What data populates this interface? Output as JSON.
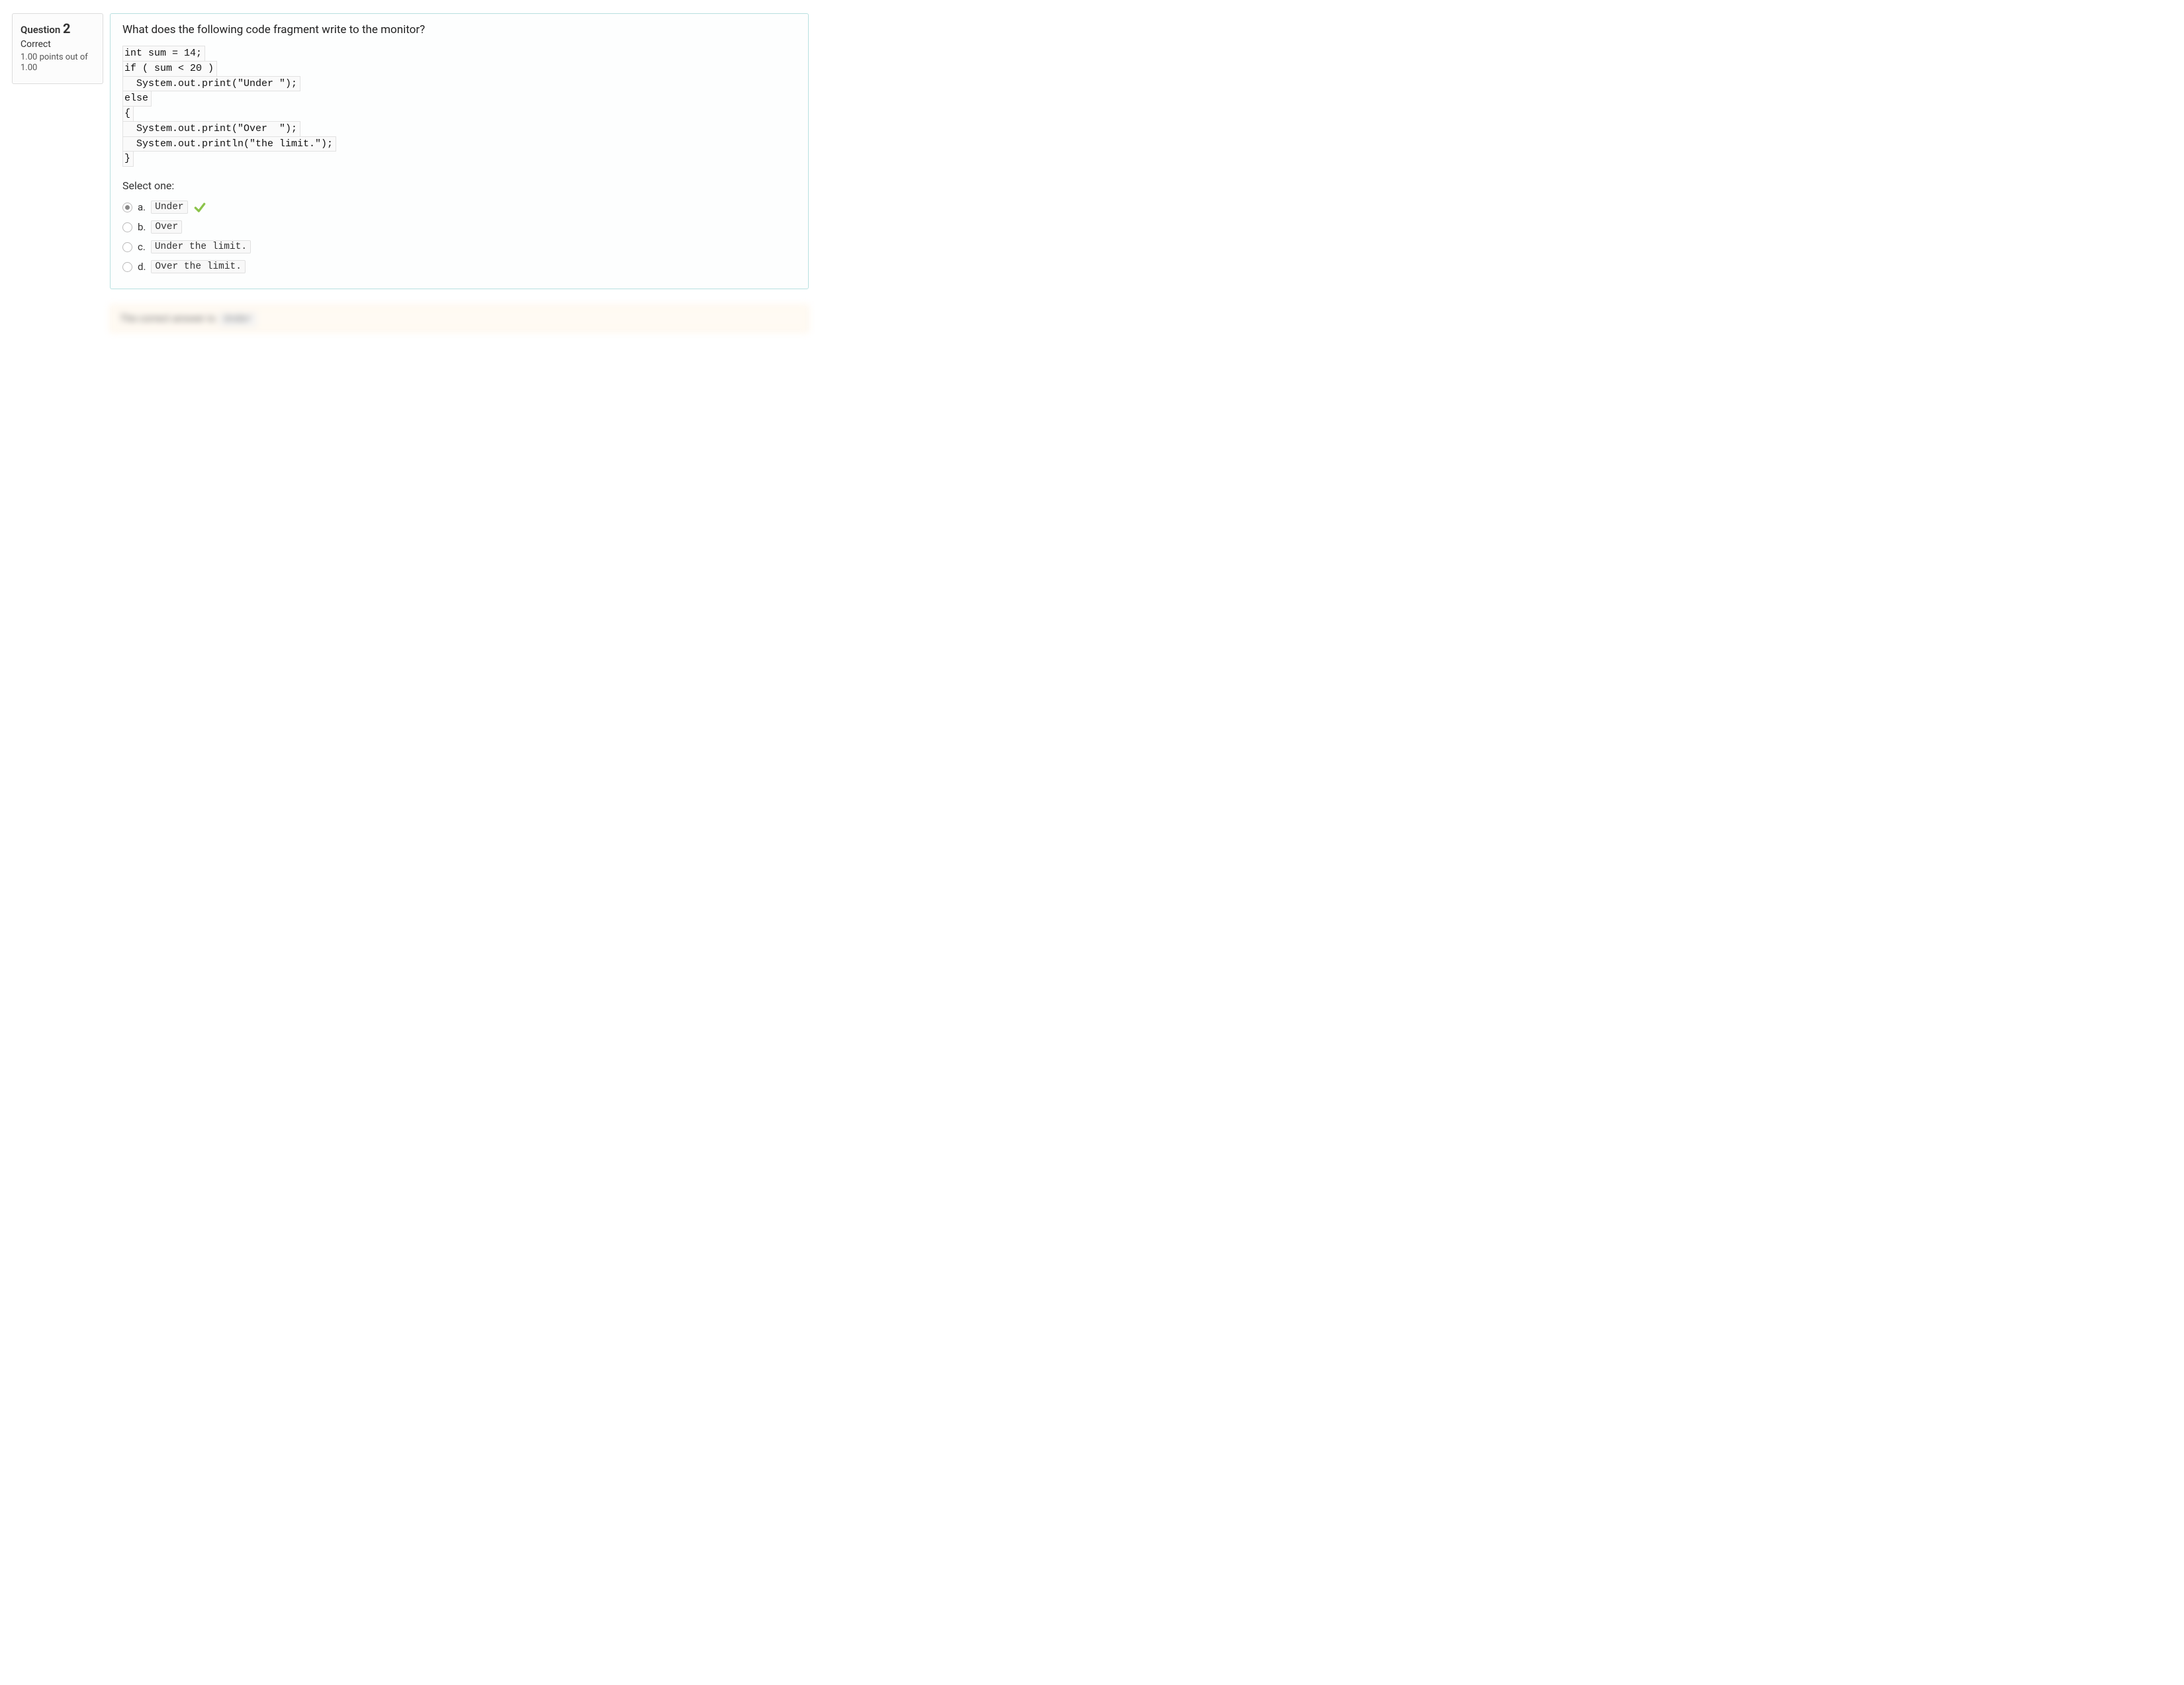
{
  "info": {
    "label": "Question",
    "number": "2",
    "status": "Correct",
    "points": "1.00 points out of 1.00"
  },
  "question": {
    "prompt": "What does the following code fragment write to the monitor?",
    "code_lines": [
      "int sum = 14;",
      "if ( sum < 20 )",
      "  System.out.print(\"Under \");",
      "else",
      "{",
      "  System.out.print(\"Over  \");",
      "  System.out.println(\"the limit.\");",
      "}"
    ],
    "select_prompt": "Select one:",
    "answers": [
      {
        "letter": "a.",
        "text": "Under",
        "checked": true,
        "correct": true
      },
      {
        "letter": "b.",
        "text": "Over",
        "checked": false,
        "correct": false
      },
      {
        "letter": "c.",
        "text": "Under the limit.",
        "checked": false,
        "correct": false
      },
      {
        "letter": "d.",
        "text": "Over the limit.",
        "checked": false,
        "correct": false
      }
    ]
  },
  "feedback": {
    "text": "The correct answer is:",
    "answer": "Under"
  }
}
